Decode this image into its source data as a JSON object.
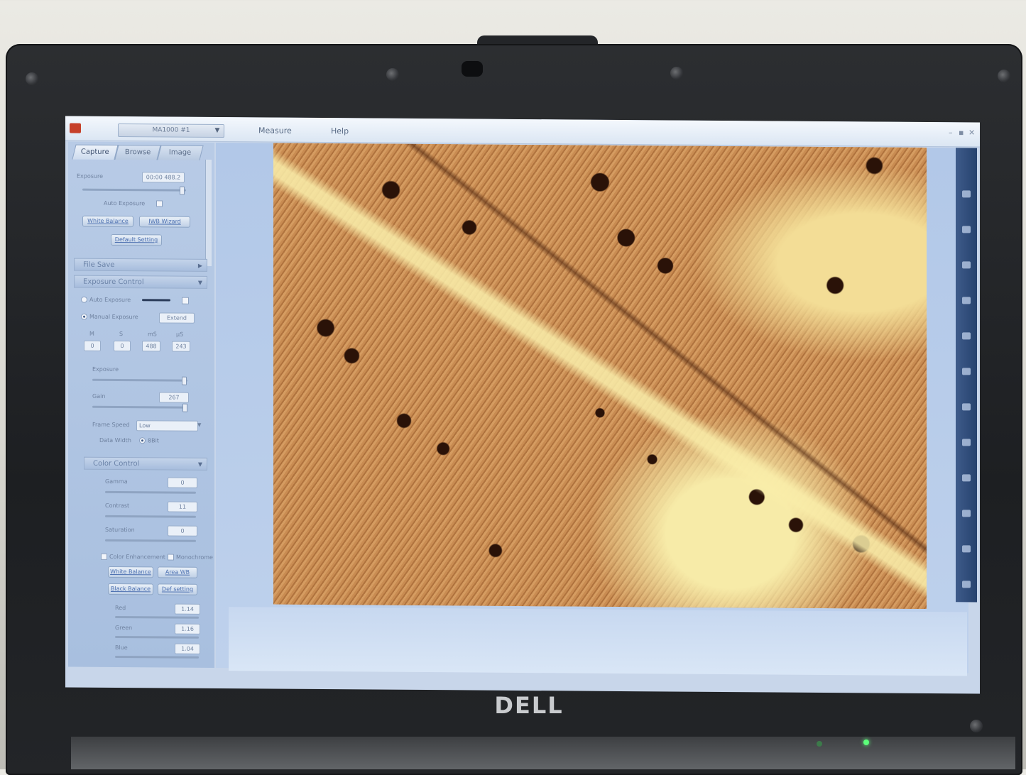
{
  "app": {
    "camera_select": "MA1000 #1",
    "menu": [
      "Measure",
      "Help"
    ],
    "window_controls": [
      "–",
      "▪",
      "✕"
    ]
  },
  "left_panel": {
    "tabs": [
      "Capture",
      "Browse",
      "Image"
    ],
    "capture": {
      "exposure_label": "Exposure",
      "exposure_value": "00:00 488.2",
      "exposure_slider": 0.96,
      "auto_exposure_label": "Auto Exposure",
      "white_balance_button": "White Balance",
      "iwb_wizard_button": "IWB Wizard",
      "default_setting_button": "Default Setting"
    },
    "file_save": {
      "header": "File Save"
    },
    "exposure_control": {
      "header": "Exposure Control",
      "auto_exposure_label": "Auto Exposure",
      "manual_exposure_label": "Manual Exposure",
      "extend_button": "Extend",
      "unit_labels": [
        "M",
        "S",
        "mS",
        "μS"
      ],
      "unit_values": [
        "0",
        "0",
        "488",
        "243"
      ],
      "exposure_label": "Exposure",
      "exposure_slider": 0.96,
      "gain_label": "Gain",
      "gain_value": "267",
      "gain_slider": 0.97,
      "frame_speed_label": "Frame Speed",
      "frame_speed_value": "Low",
      "data_width_label": "Data Width",
      "data_width_value": "8Bit"
    },
    "color_control": {
      "header": "Color Control",
      "gamma_label": "Gamma",
      "gamma_value": "0",
      "contrast_label": "Contrast",
      "contrast_value": "11",
      "saturation_label": "Saturation",
      "saturation_value": "0",
      "color_enhancement_label": "Color Enhancement",
      "monochrome_label": "Monochrome",
      "white_balance_button": "White Balance",
      "area_wb_button": "Area WB",
      "black_balance_button": "Black Balance",
      "def_setting_button": "Def setting",
      "red_label": "Red",
      "red_value": "1.14",
      "green_label": "Green",
      "green_value": "1.16",
      "blue_label": "Blue",
      "blue_value": "1.04"
    }
  },
  "hardware": {
    "brand": "DELL"
  }
}
